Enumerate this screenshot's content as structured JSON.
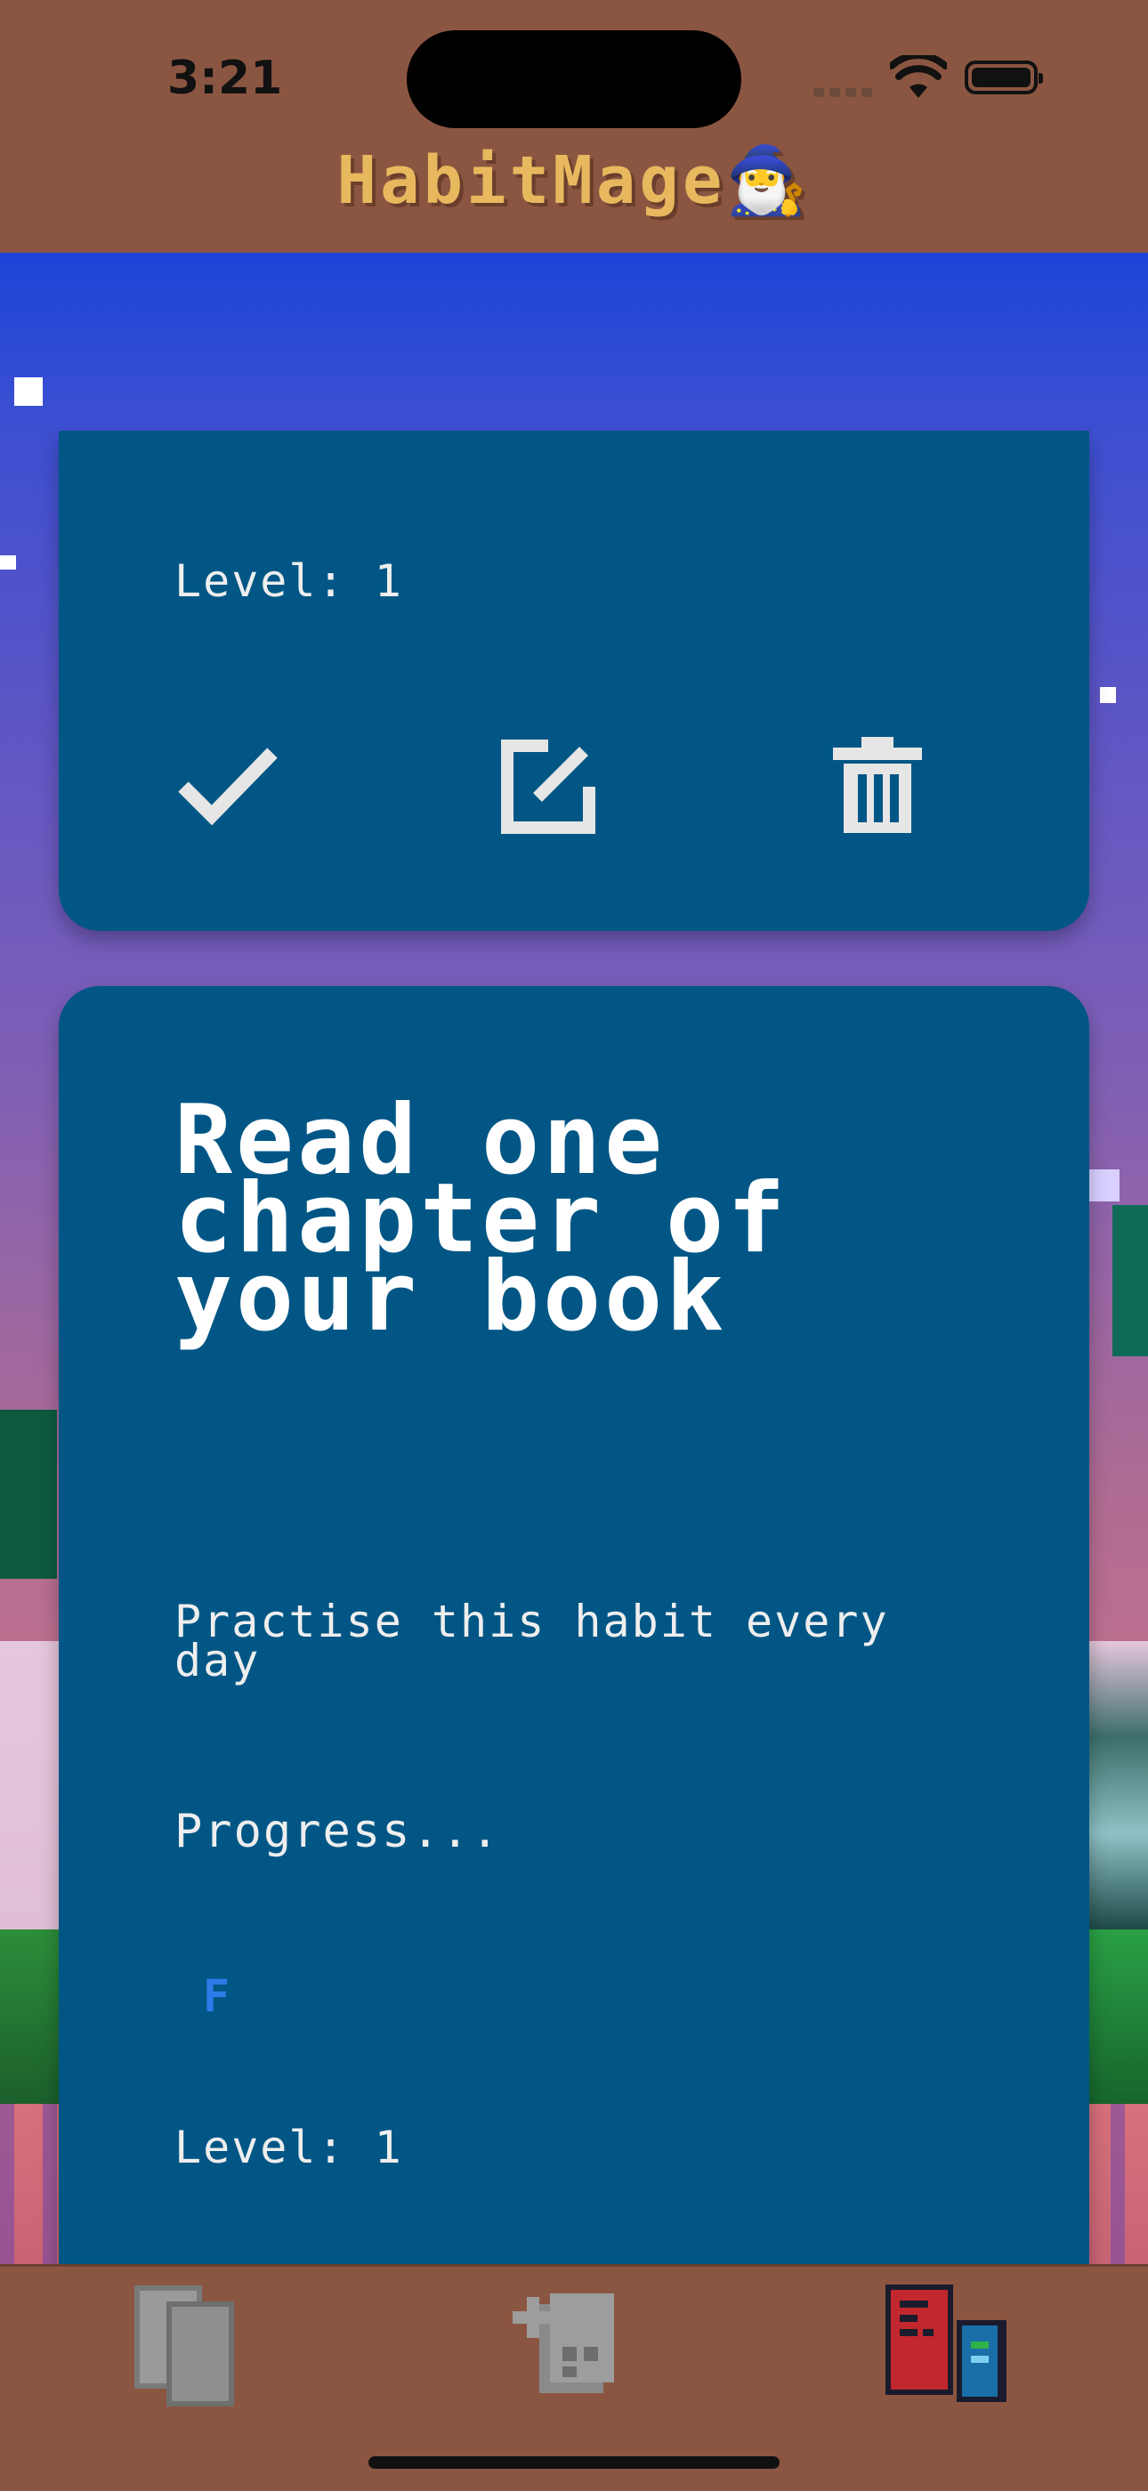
{
  "status_bar": {
    "time": "3:21"
  },
  "header": {
    "title": "HabitMage",
    "title_emoji": "🧙‍♂️"
  },
  "colors": {
    "card": "#015685",
    "header": "#8b5641",
    "title": "#e7b85e",
    "grade": "#2b7ce8"
  },
  "cards": [
    {
      "level_text": "Level: 1"
    },
    {
      "title": "Read one chapter of your book",
      "frequency": "Practise this habit every day",
      "progress_label": "Progress...",
      "grade": "F",
      "level_text": "Level: 1"
    }
  ],
  "icons": {
    "complete": "checkmark-icon",
    "edit": "edit-icon",
    "delete": "trash-icon",
    "tab_1": "cards-icon",
    "tab_2": "add-habit-icon",
    "tab_3": "books-icon"
  }
}
